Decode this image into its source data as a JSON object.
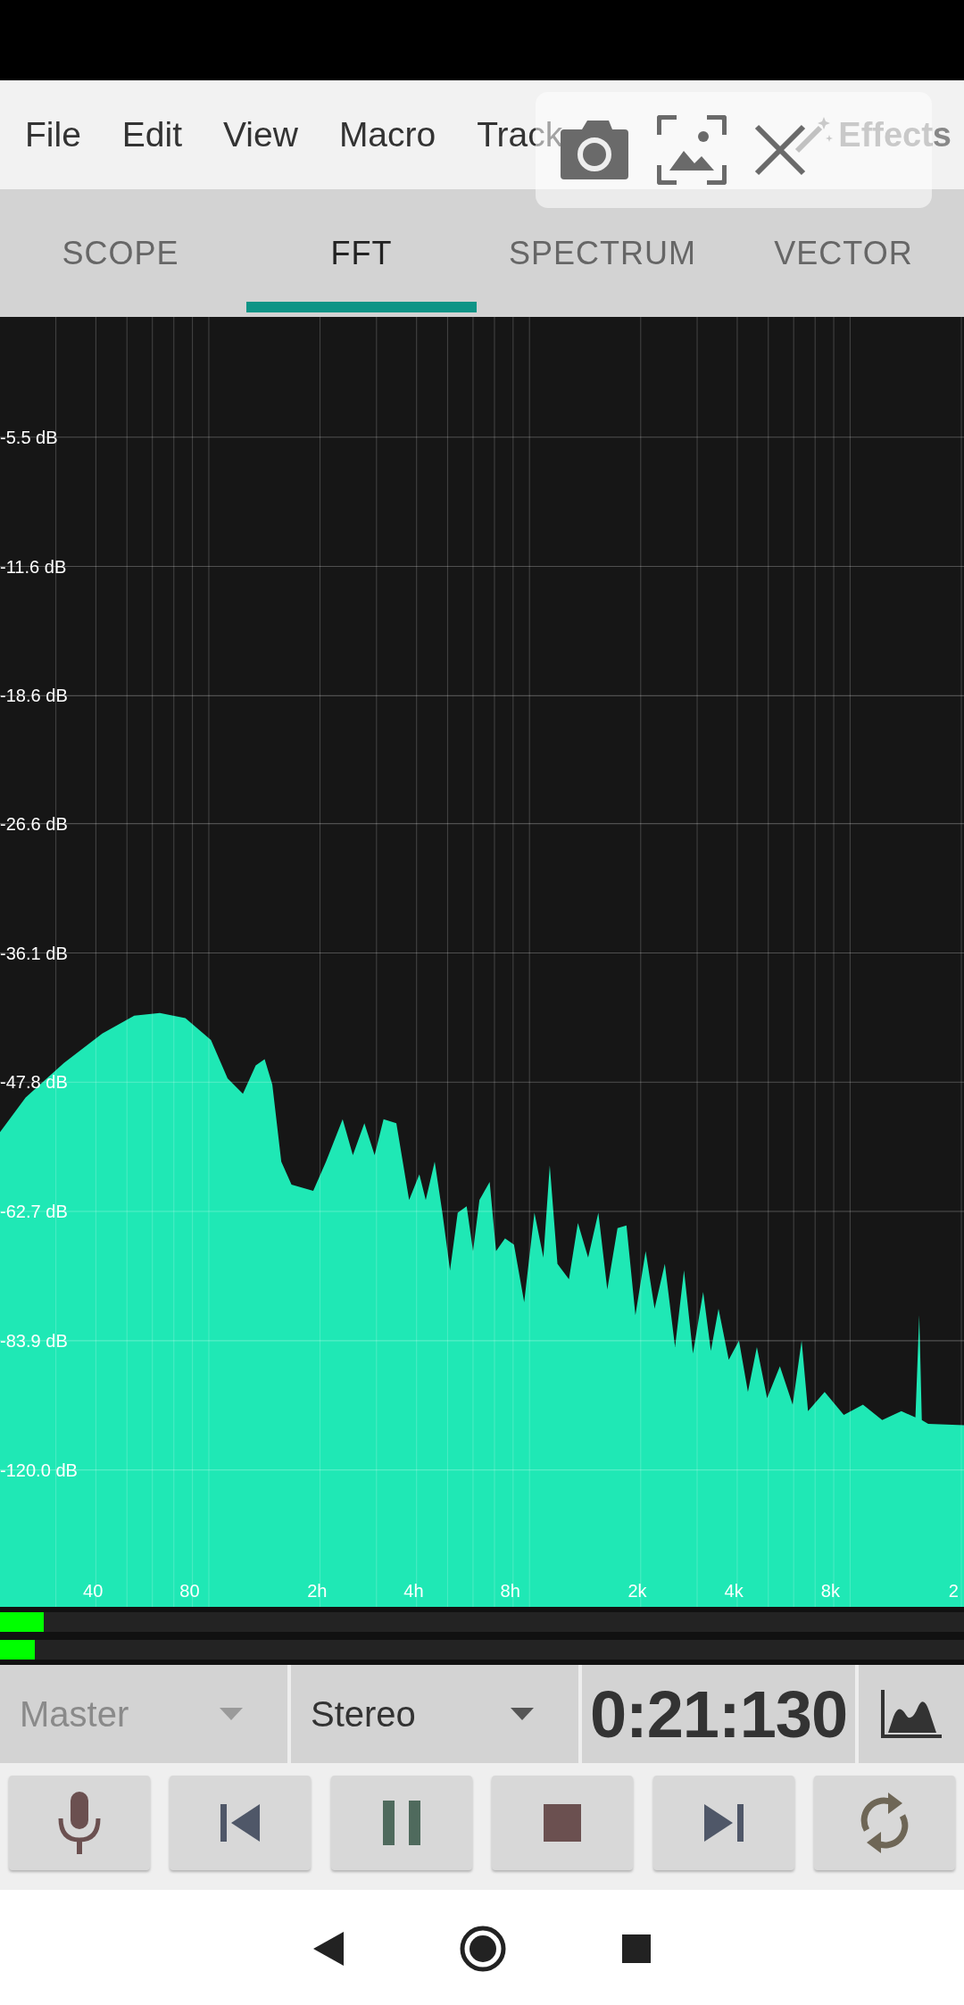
{
  "menu": [
    "File",
    "Edit",
    "View",
    "Macro",
    "Track",
    "Effects"
  ],
  "tabs": [
    {
      "label": "SCOPE",
      "selected": false
    },
    {
      "label": "FFT",
      "selected": true
    },
    {
      "label": "SPECTRUM",
      "selected": false
    },
    {
      "label": "VECTOR",
      "selected": false
    }
  ],
  "chart": {
    "y_labels": [
      "-5.5 dB",
      "-11.6 dB",
      "-18.6 dB",
      "-26.6 dB",
      "-36.1 dB",
      "-47.8 dB",
      "-62.7 dB",
      "-83.9 dB",
      "-120.0 dB"
    ],
    "x_labels": [
      "40",
      "80",
      "2h",
      "4h",
      "8h",
      "2k",
      "4k",
      "8k",
      "2"
    ]
  },
  "meters": [
    {
      "level": 0.045
    },
    {
      "level": 0.036
    }
  ],
  "selectors": [
    {
      "label": "Master",
      "disabled": true
    },
    {
      "label": "Stereo",
      "disabled": false
    }
  ],
  "time": "0:21:130",
  "transport": [
    {
      "kind": "mic"
    },
    {
      "kind": "prev"
    },
    {
      "kind": "pause"
    },
    {
      "kind": "stop"
    },
    {
      "kind": "next"
    },
    {
      "kind": "loop"
    }
  ]
}
